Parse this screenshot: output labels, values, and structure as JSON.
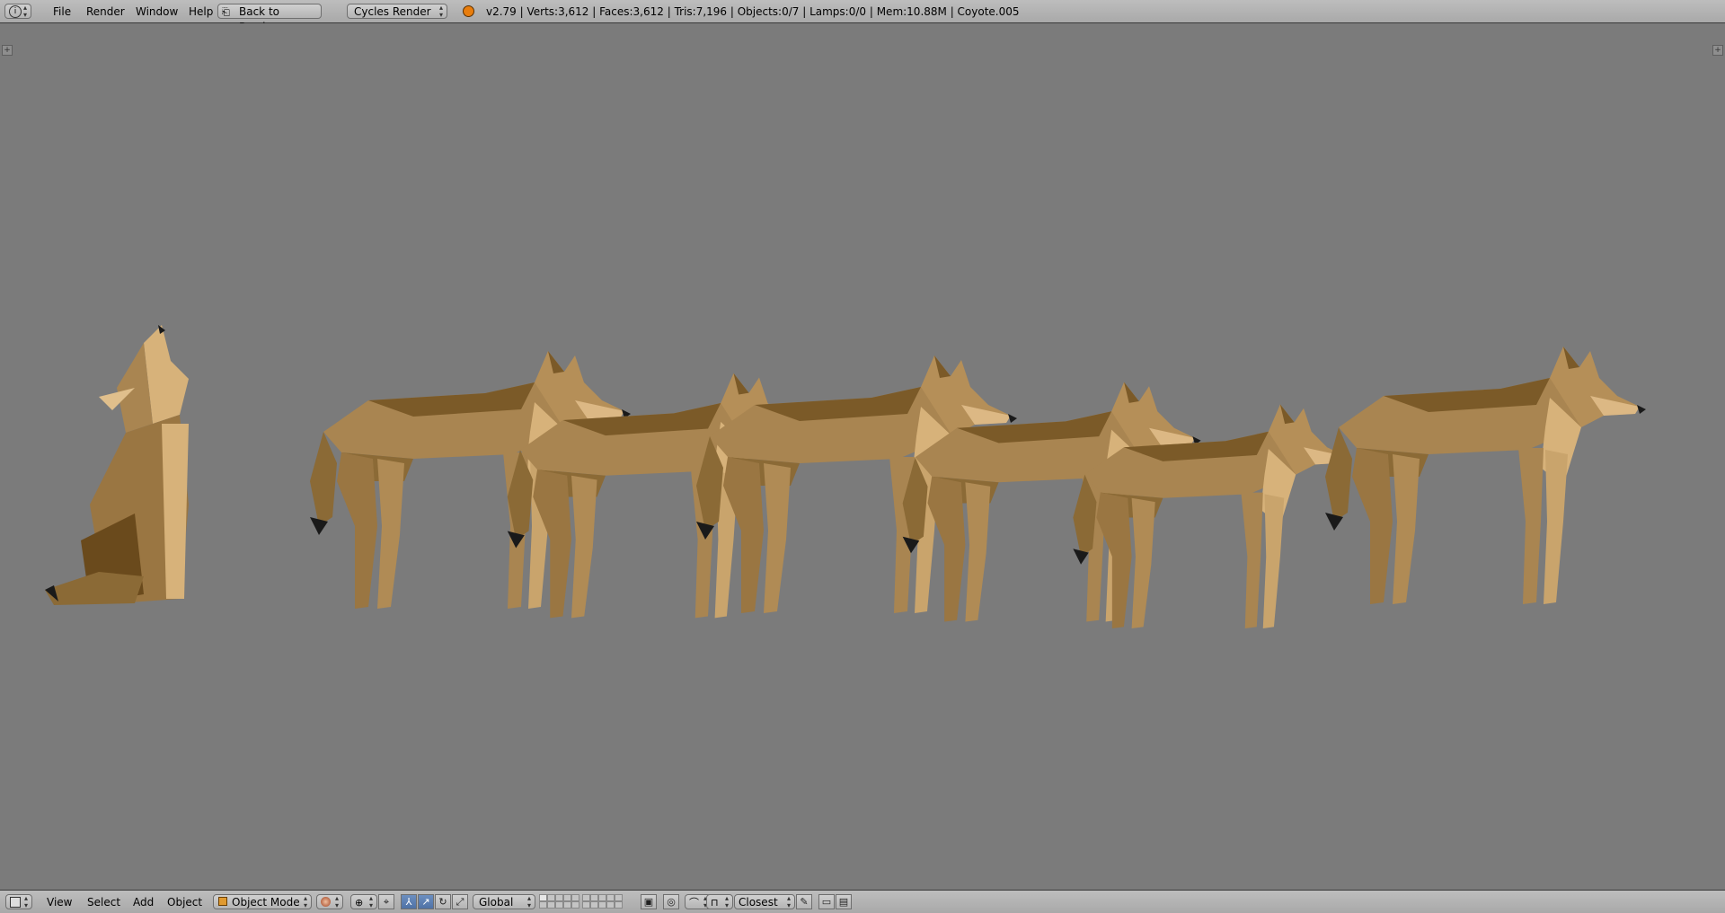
{
  "top_header": {
    "menus": [
      "File",
      "Render",
      "Window",
      "Help"
    ],
    "back_button": "Back to Previous",
    "render_engine": "Cycles Render",
    "stats": "v2.79 | Verts:3,612 | Faces:3,612 | Tris:7,196 | Objects:0/7 | Lamps:0/0 | Mem:10.88M | Coyote.005"
  },
  "viewport": {
    "background_color": "#7b7b7b",
    "subject": "seven low-poly coyote models in side view"
  },
  "bottom_header": {
    "menus": [
      "View",
      "Select",
      "Add",
      "Object"
    ],
    "mode": "Object Mode",
    "orientation": "Global",
    "snap_target": "Closest"
  },
  "colors": {
    "header_bg": "#b4b4b4",
    "coyote_base": "#a98551",
    "coyote_light": "#d7b27a",
    "coyote_dark": "#6a4a1c",
    "coyote_nose": "#1a1a1a",
    "active_button": "#5a7db3"
  }
}
